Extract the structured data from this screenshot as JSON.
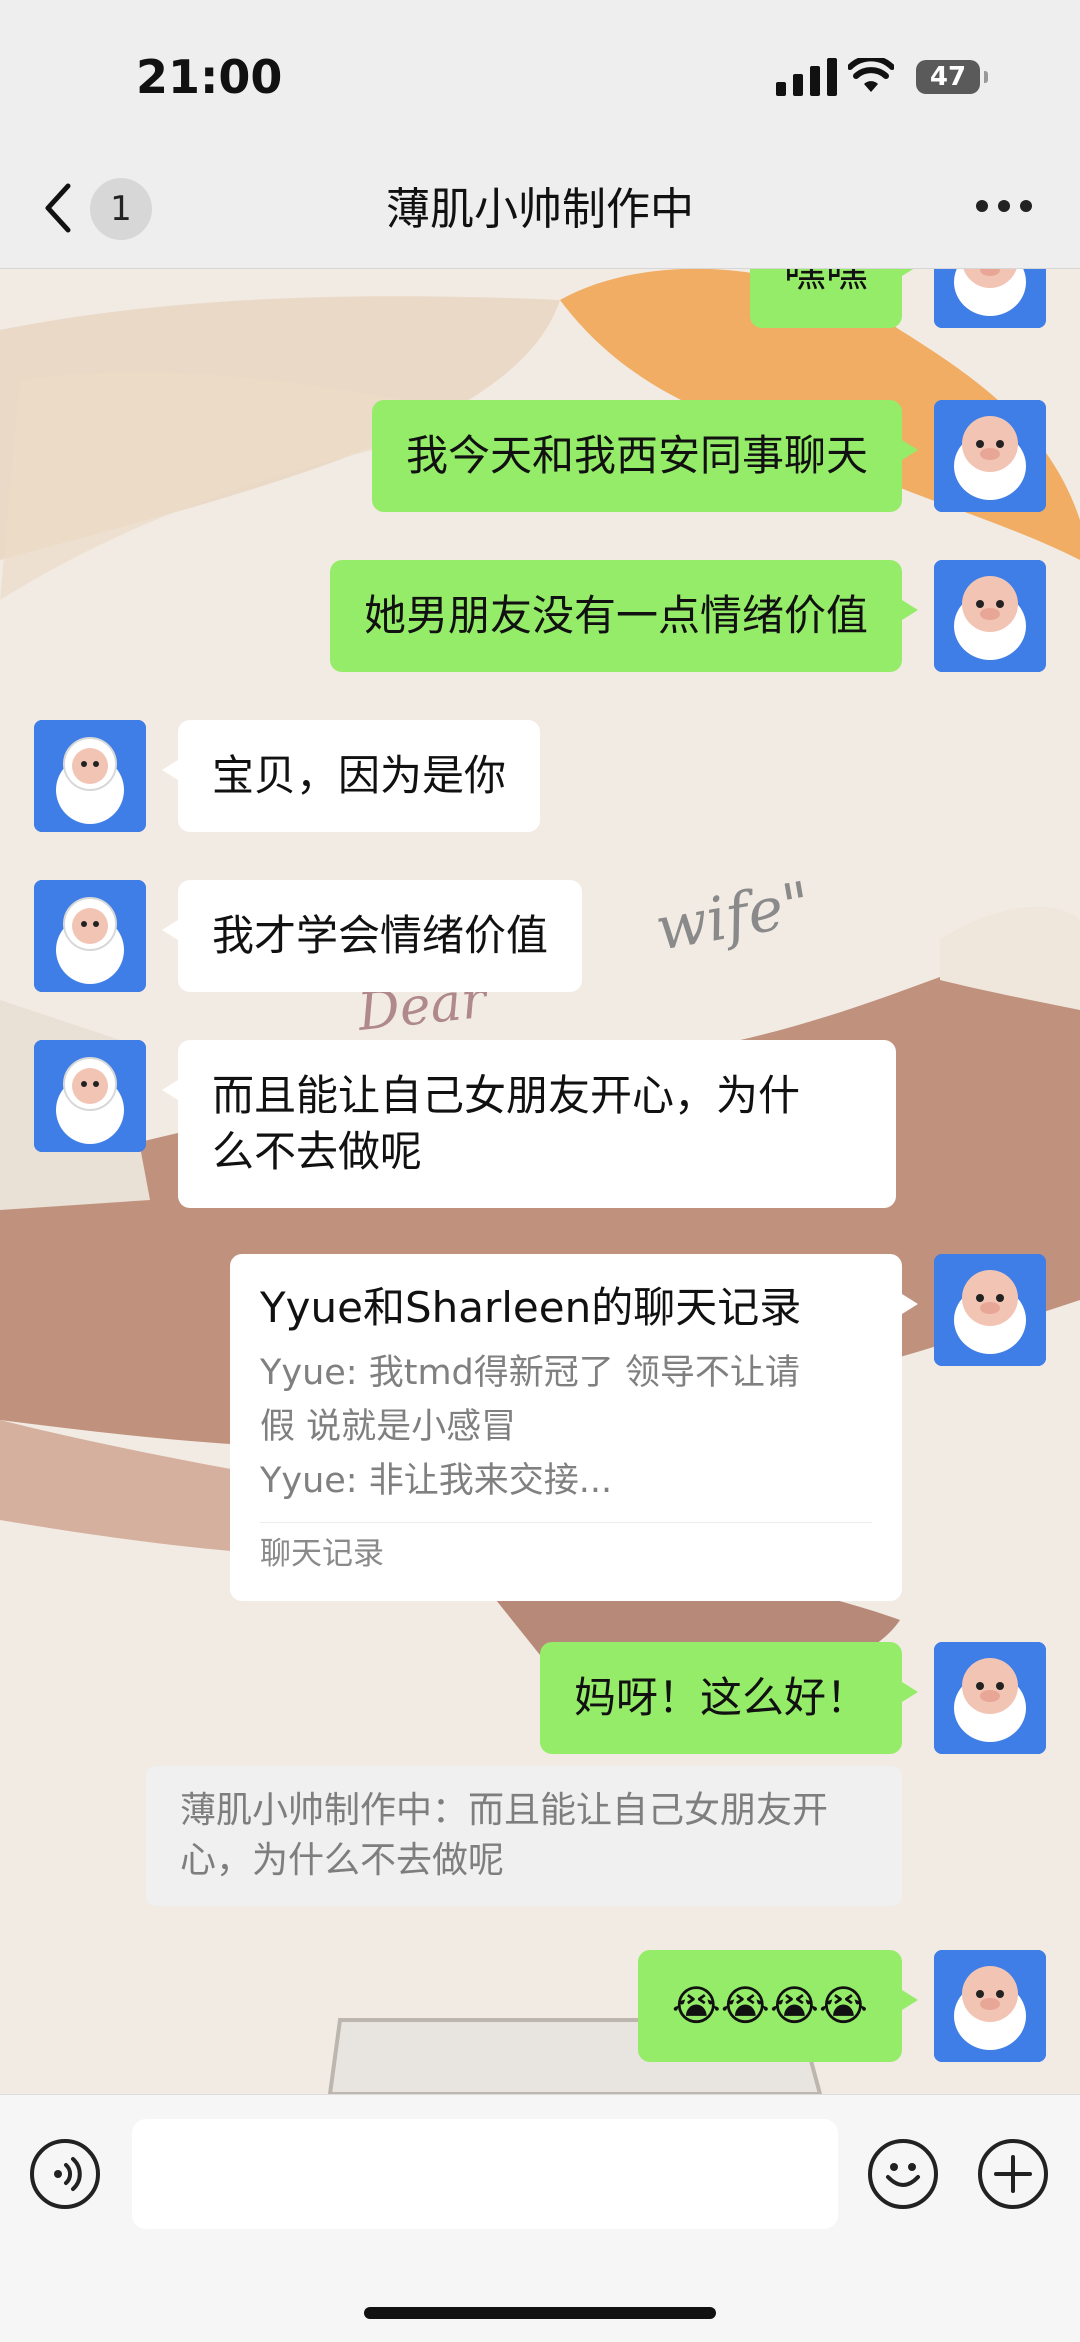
{
  "status_bar": {
    "time": "21:00",
    "battery": "47"
  },
  "header": {
    "unread_count": "1",
    "title": "薄肌小帅制作中"
  },
  "messages": [
    {
      "side": "me",
      "text": "嘿嘿"
    },
    {
      "side": "me",
      "text": "我今天和我西安同事聊天"
    },
    {
      "side": "me",
      "text": "她男朋友没有一点情绪价值"
    },
    {
      "side": "other",
      "text": "宝贝，因为是你"
    },
    {
      "side": "other",
      "text": "我才学会情绪价值"
    },
    {
      "side": "other",
      "lines": [
        "而且能让自己女朋友开心，为什",
        "么不去做呢"
      ]
    },
    {
      "side": "me",
      "type": "chat_record",
      "title": "Yyue和Sharleen的聊天记录",
      "lines": [
        "Yyue: 我tmd得新冠了 领导不让请",
        "假 说就是小感冒",
        "Yyue: 非让我来交接..."
      ],
      "footer": "聊天记录"
    },
    {
      "side": "me",
      "text": "妈呀！这么好！"
    },
    {
      "type": "quote",
      "lines": [
        "薄肌小帅制作中：而且能让自己女朋友开",
        "心，为什么不去做呢"
      ]
    },
    {
      "side": "me",
      "text": "😭😭😭😭"
    }
  ],
  "background_text": "Dear wife",
  "colors": {
    "my_bubble": "#95ec69",
    "other_bubble": "#ffffff",
    "avatar_bg": "#3f7ee6",
    "header_bg": "#ededed"
  },
  "icons": [
    "back-chevron-icon",
    "more-dots-icon",
    "voice-icon",
    "emoji-icon",
    "plus-icon"
  ]
}
